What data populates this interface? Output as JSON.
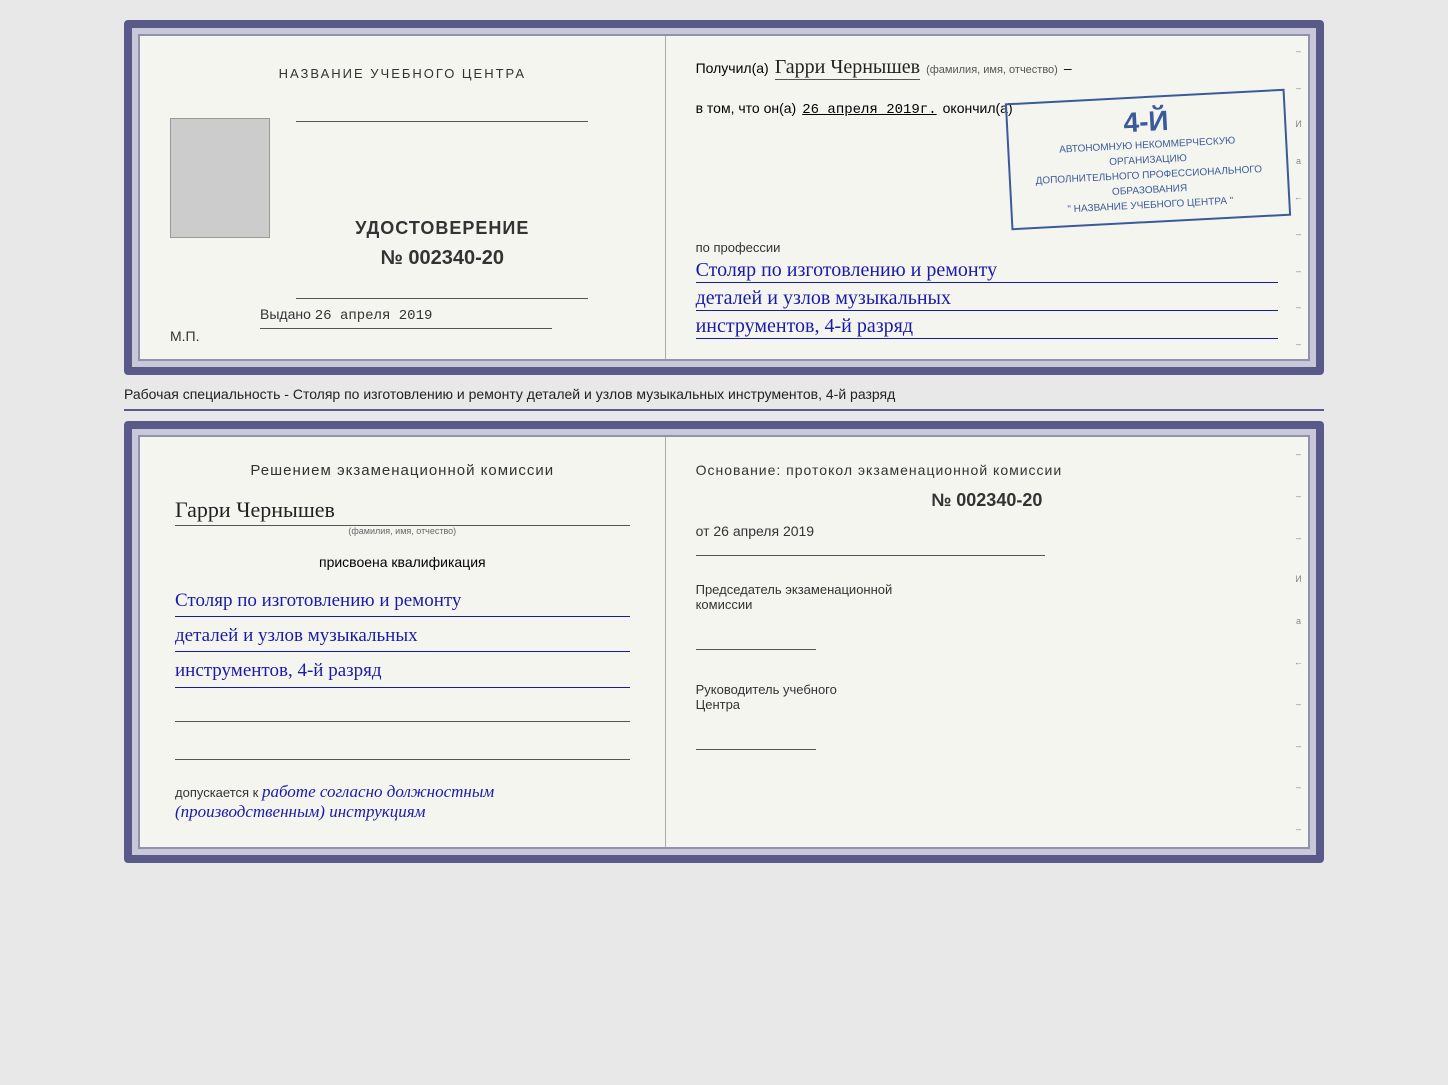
{
  "cert_top": {
    "left": {
      "title_top": "НАЗВАНИЕ УЧЕБНОГО ЦЕНТРА",
      "main_title": "УДОСТОВЕРЕНИЕ",
      "number": "№ 002340-20",
      "issued_label": "Выдано",
      "issued_date": "26 апреля 2019",
      "mp_label": "М.П."
    },
    "right": {
      "received_label": "Получил(а)",
      "recipient_name": "Гарри Чернышев",
      "fio_label": "(фамилия, имя, отчество)",
      "in_that_label": "в том, что он(а)",
      "date_value": "26 апреля 2019г.",
      "completed_label": "окончил(а)",
      "stamp_line1": "АВТОНОМНУЮ НЕКОММЕРЧЕСКУЮ ОРГАНИЗАЦИЮ",
      "stamp_line2": "ДОПОЛНИТЕЛЬНОГО ПРОФЕССИОНАЛЬНОГО ОБРАЗОВАНИЯ",
      "stamp_line3": "\" НАЗВАНИЕ УЧЕБНОГО ЦЕНТРА \"",
      "stamp_grade": "4-й",
      "profession_label": "по профессии",
      "profession_line1": "Столяр по изготовлению и ремонту",
      "profession_line2": "деталей и узлов музыкальных",
      "profession_line3": "инструментов, 4-й разряд"
    }
  },
  "caption": "Рабочая специальность - Столяр по изготовлению и ремонту деталей и узлов музыкальных\nинструментов, 4-й разряд",
  "back_left": {
    "decision_title": "Решением  экзаменационной  комиссии",
    "name_value": "Гарри Чернышев",
    "fio_label": "(фамилия, имя, отчество)",
    "qualification_assigned": "присвоена квалификация",
    "qual_line1": "Столяр по изготовлению и ремонту",
    "qual_line2": "деталей и узлов музыкальных",
    "qual_line3": "инструментов, 4-й разряд",
    "admission_label": "допускается к",
    "admission_value": "работе согласно должностным\n(производственным) инструкциям"
  },
  "back_right": {
    "basis_label": "Основание: протокол экзаменационной  комиссии",
    "protocol_number": "№  002340-20",
    "date_prefix": "от",
    "date_value": "26 апреля 2019",
    "chairman_label": "Председатель экзаменационной\nкомиссии",
    "head_label": "Руководитель учебного\nЦентра"
  },
  "edge_marks": {
    "marks": [
      "И",
      "а",
      "←",
      "–",
      "–",
      "–",
      "–"
    ]
  }
}
